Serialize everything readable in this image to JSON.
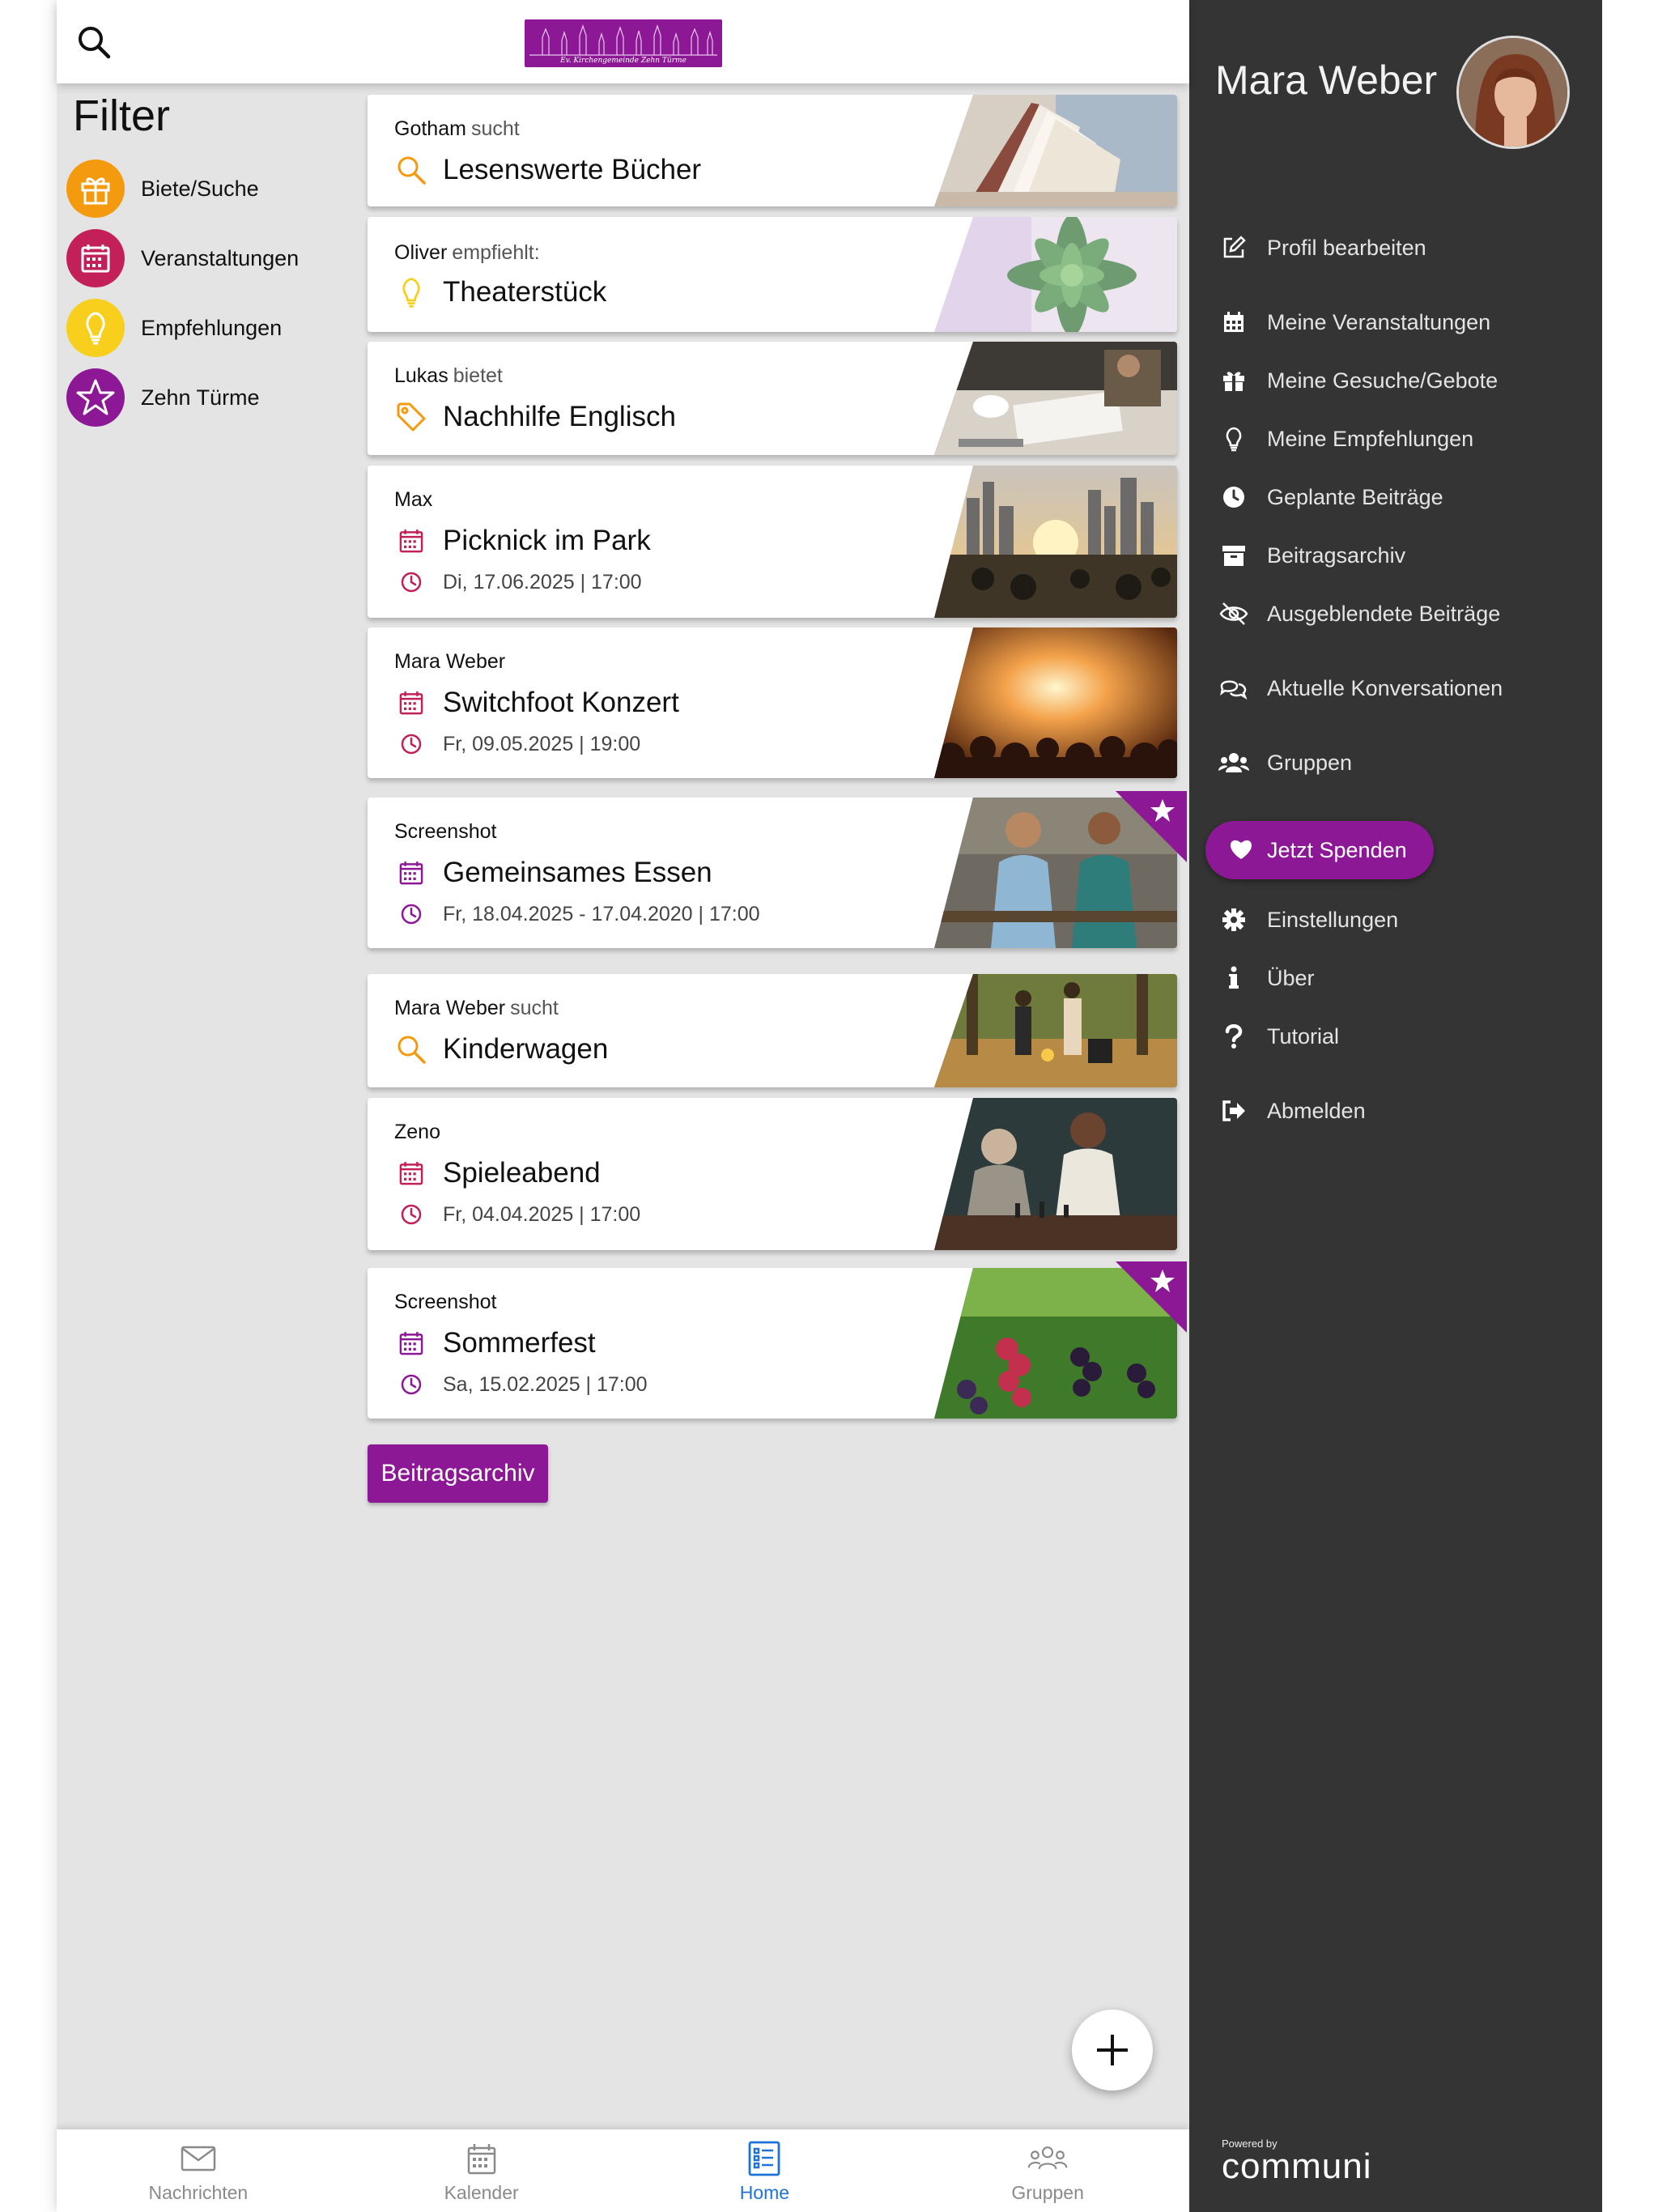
{
  "header": {
    "logo_text": "Ev. Kirchengemeinde Zehn Türme"
  },
  "filter": {
    "title": "Filter",
    "items": [
      {
        "label": "Biete/Suche",
        "color": "#f39a0f",
        "icon": "gift-icon"
      },
      {
        "label": "Veranstaltungen",
        "color": "#c3205a",
        "icon": "calendar-icon"
      },
      {
        "label": "Empfehlungen",
        "color": "#f7cf1c",
        "icon": "lightbulb-icon"
      },
      {
        "label": "Zehn Türme",
        "color": "#8d1896",
        "icon": "star-icon"
      }
    ]
  },
  "posts": [
    {
      "author": "Gotham",
      "verb": "sucht",
      "title": "Lesenswerte Bücher",
      "type": "search",
      "date": ""
    },
    {
      "author": "Oliver",
      "verb": "empfiehlt:",
      "title": "Theaterstück",
      "type": "recommend",
      "date": ""
    },
    {
      "author": "Lukas",
      "verb": "bietet",
      "title": "Nachhilfe Englisch",
      "type": "offer",
      "date": ""
    },
    {
      "author": "Max",
      "verb": "",
      "title": "Picknick im Park",
      "type": "event",
      "date": "Di, 17.06.2025 | 17:00"
    },
    {
      "author": "Mara Weber",
      "verb": "",
      "title": "Switchfoot Konzert",
      "type": "event",
      "date": "Fr, 09.05.2025 | 19:00"
    },
    {
      "author": "Screenshot",
      "verb": "",
      "title": "Gemeinsames Essen",
      "type": "event-group",
      "date": "Fr, 18.04.2025 - 17.04.2020 | 17:00"
    },
    {
      "author": "Mara Weber",
      "verb": "sucht",
      "title": "Kinderwagen",
      "type": "search",
      "date": ""
    },
    {
      "author": "Zeno",
      "verb": "",
      "title": "Spieleabend",
      "type": "event",
      "date": "Fr, 04.04.2025 | 17:00"
    },
    {
      "author": "Screenshot",
      "verb": "",
      "title": "Sommerfest",
      "type": "event-group",
      "date": "Sa, 15.02.2025 | 17:00"
    }
  ],
  "archive_button": "Beitragsarchiv",
  "bottom_nav": [
    {
      "label": "Nachrichten",
      "icon": "mail-icon",
      "active": false
    },
    {
      "label": "Kalender",
      "icon": "calendar-icon",
      "active": false
    },
    {
      "label": "Home",
      "icon": "list-icon",
      "active": true
    },
    {
      "label": "Gruppen",
      "icon": "group-icon",
      "active": false
    }
  ],
  "sidebar": {
    "user_name": "Mara Weber",
    "menu": [
      {
        "label": "Profil bearbeiten",
        "icon": "edit-icon"
      },
      {
        "label": "Meine Veranstaltungen",
        "icon": "calendar-icon"
      },
      {
        "label": "Meine Gesuche/Gebote",
        "icon": "gift-icon"
      },
      {
        "label": "Meine Empfehlungen",
        "icon": "lightbulb-icon"
      },
      {
        "label": "Geplante Beiträge",
        "icon": "clock-icon"
      },
      {
        "label": "Beitragsarchiv",
        "icon": "archive-icon"
      },
      {
        "label": "Ausgeblendete Beiträge",
        "icon": "eye-slash-icon"
      },
      {
        "label": "Aktuelle Konversationen",
        "icon": "chat-icon"
      },
      {
        "label": "Gruppen",
        "icon": "users-icon"
      },
      {
        "label": "Einstellungen",
        "icon": "gear-icon"
      },
      {
        "label": "Über",
        "icon": "info-icon"
      },
      {
        "label": "Tutorial",
        "icon": "question-icon"
      },
      {
        "label": "Abmelden",
        "icon": "logout-icon"
      }
    ],
    "donate": "Jetzt Spenden",
    "powered_by": "Powered by",
    "brand": "communi"
  },
  "colors": {
    "brand_purple": "#8d1896",
    "search_orange": "#f39a0f",
    "event_red": "#c3205a",
    "recommend_yellow": "#f7cf1c",
    "active_blue": "#1e73d8",
    "sidebar_bg": "#343434"
  }
}
